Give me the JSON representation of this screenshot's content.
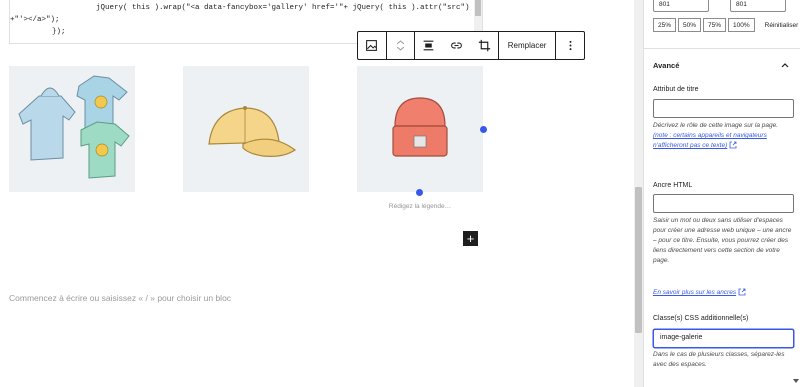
{
  "code": {
    "lines": [
      "jQuery( this ).wrap(\"<a data-fancybox='gallery' href='\"+ jQuery( this ).attr(\"src\")",
      "+\"'></a>\");",
      "});"
    ]
  },
  "toolbar": {
    "image_icon": "image-icon",
    "move_icon": "move-updown-icon",
    "align_icon": "align-icon",
    "link_icon": "link-icon",
    "crop_icon": "crop-icon",
    "replace_label": "Remplacer",
    "more_icon": "more-vertical-icon"
  },
  "gallery": {
    "images": [
      "hoodie-and-tshirts",
      "cap",
      "beanie"
    ],
    "caption_placeholder": "Rédigez la légende…"
  },
  "editor": {
    "placeholder": "Commencez à écrire ou saisissez « / » pour choisir un bloc"
  },
  "sidebar": {
    "width_value": "801",
    "height_value": "801",
    "size_buttons": [
      "25%",
      "50%",
      "75%",
      "100%"
    ],
    "reset_label": "Réinitialiser",
    "advanced": {
      "title": "Avancé",
      "title_attr_label": "Attribut de titre",
      "title_attr_value": "",
      "title_help": "Décrivez le rôle de cette image sur la page.",
      "title_help_link": "(note : certains appareils et navigateurs n'afficheront pas ce texte)",
      "anchor_label": "Ancre HTML",
      "anchor_value": "",
      "anchor_help": "Saisir un mot ou deux sans utiliser d'espaces pour créer une adresse web unique – une ancre – pour ce titre. Ensuite, vous pourrez créer des liens directement vers cette section de votre page.",
      "anchor_link": "En savoir plus sur les ancres",
      "css_label": "Classe(s) CSS additionnelle(s)",
      "css_value": "image-galerie",
      "css_help": "Dans le cas de plusieurs classes, séparez-les avec des espaces."
    }
  },
  "colors": {
    "accent": "#3858e9",
    "text": "#1e1e1e",
    "muted": "#949494"
  }
}
